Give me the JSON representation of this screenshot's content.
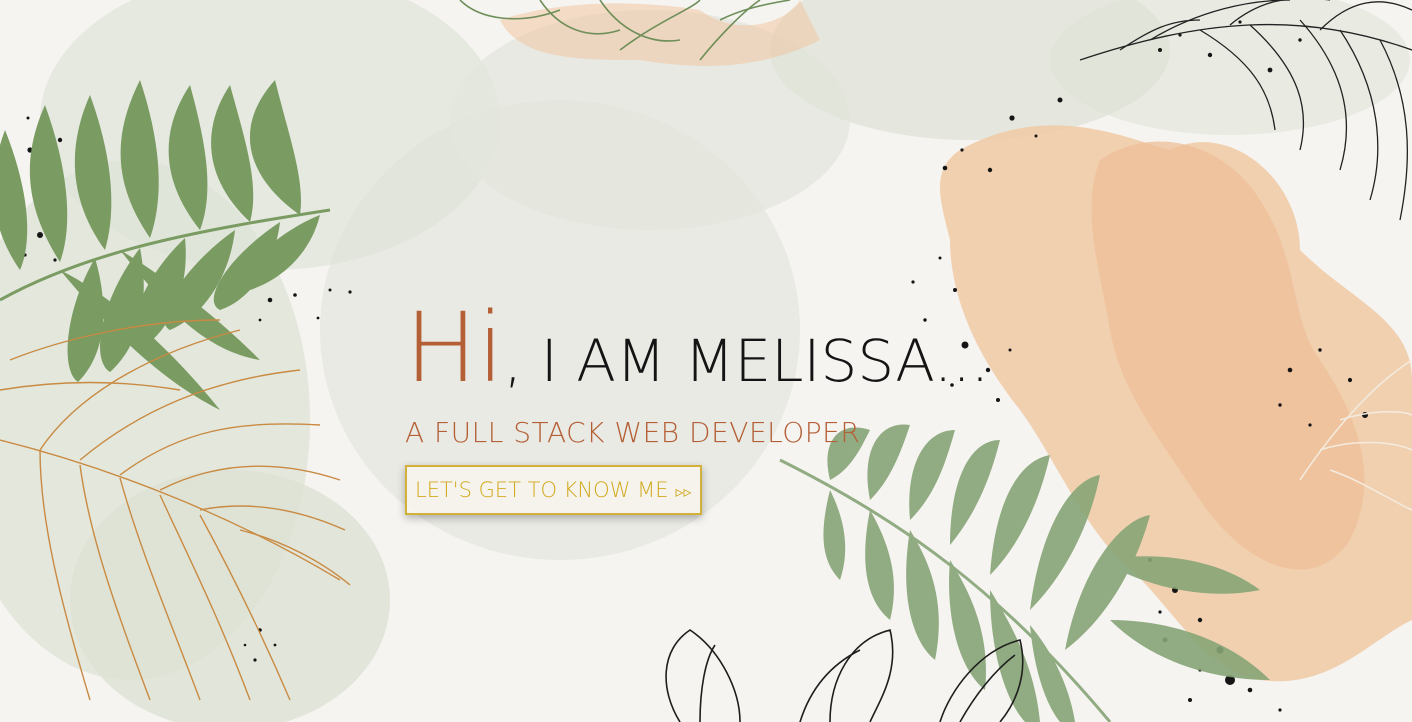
{
  "hero": {
    "greeting": "Hi",
    "intro": ", I AM MELISSA...",
    "subtitle": "A FULL STACK WEB DEVELOPER",
    "cta_label": "LET'S GET TO KNOW ME",
    "cta_arrow": "▹▹"
  },
  "colors": {
    "accent": "#b45f36",
    "cta": "#d2a91e",
    "sage": "#7d9e66",
    "peach": "#efc9a4",
    "background": "#f6f4f1"
  },
  "icons": {
    "cta_arrow": "double-chevron-right-icon"
  }
}
